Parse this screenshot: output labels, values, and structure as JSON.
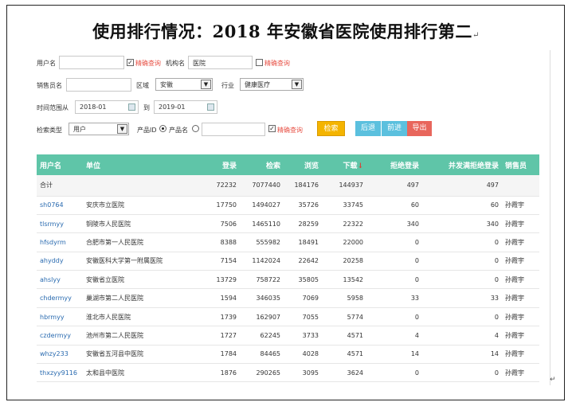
{
  "title": "使用排行情况：2018 年安徽省医院使用排行第二",
  "para_mark": "↵",
  "filters": {
    "username_label": "用户名",
    "username_value": "",
    "exact_label_1": "精确查询",
    "org_label": "机构名",
    "org_value": "医院",
    "exact_label_2": "精确查询",
    "sales_label": "销售员名",
    "sales_value": "",
    "region_label": "区域",
    "region_value": "安徽",
    "industry_label": "行业",
    "industry_value": "健康医疗",
    "time_label": "时间范围从",
    "time_from": "2018-01",
    "time_to_label": "到",
    "time_to": "2019-01",
    "search_type_label": "检索类型",
    "search_type_value": "用户",
    "product_id_label": "产品ID",
    "product_name_label": "产品名",
    "product_value": "",
    "exact_label_3": "精确查询"
  },
  "buttons": {
    "search": "检索",
    "back": "后退",
    "forward": "前进",
    "export": "导出"
  },
  "colors": {
    "header_green": "#5fc5a8",
    "search_orange": "#f4b400",
    "nav_blue": "#5bc0de",
    "export_red": "#e8665c",
    "link_blue": "#2a6bb0"
  },
  "table": {
    "headers": [
      "用户名",
      "单位",
      "登录",
      "检索",
      "浏览",
      "下载",
      "拒绝登录",
      "并发满拒绝登录",
      "销售员"
    ],
    "total": [
      "合计",
      "",
      "72232",
      "7077440",
      "184176",
      "144937",
      "497",
      "497",
      ""
    ],
    "rows": [
      [
        "sh0764",
        "安庆市立医院",
        "17750",
        "1494027",
        "35726",
        "33745",
        "60",
        "60",
        "孙霞宇"
      ],
      [
        "tlsrmyy",
        "铜陵市人民医院",
        "7506",
        "1465110",
        "28259",
        "22322",
        "340",
        "340",
        "孙霞宇"
      ],
      [
        "hfsdyrm",
        "合肥市第一人民医院",
        "8388",
        "555982",
        "18491",
        "22000",
        "0",
        "0",
        "孙霞宇"
      ],
      [
        "ahyddy",
        "安徽医科大学第一附属医院",
        "7154",
        "1142024",
        "22642",
        "20258",
        "0",
        "0",
        "孙霞宇"
      ],
      [
        "ahslyy",
        "安徽省立医院",
        "13729",
        "758722",
        "35805",
        "13542",
        "0",
        "0",
        "孙霞宇"
      ],
      [
        "chdermyy",
        "巢湖市第二人民医院",
        "1594",
        "346035",
        "7069",
        "5958",
        "33",
        "33",
        "孙霞宇"
      ],
      [
        "hbrmyy",
        "淮北市人民医院",
        "1739",
        "162907",
        "7055",
        "5774",
        "0",
        "0",
        "孙霞宇"
      ],
      [
        "czdermyy",
        "池州市第二人民医院",
        "1727",
        "62245",
        "3733",
        "4571",
        "4",
        "4",
        "孙霞宇"
      ],
      [
        "whzy233",
        "安徽省五河县中医院",
        "1784",
        "84465",
        "4028",
        "4571",
        "14",
        "14",
        "孙霞宇"
      ],
      [
        "thxzyy9116",
        "太和县中医院",
        "1876",
        "290265",
        "3095",
        "3624",
        "0",
        "0",
        "孙霞宇"
      ]
    ]
  }
}
